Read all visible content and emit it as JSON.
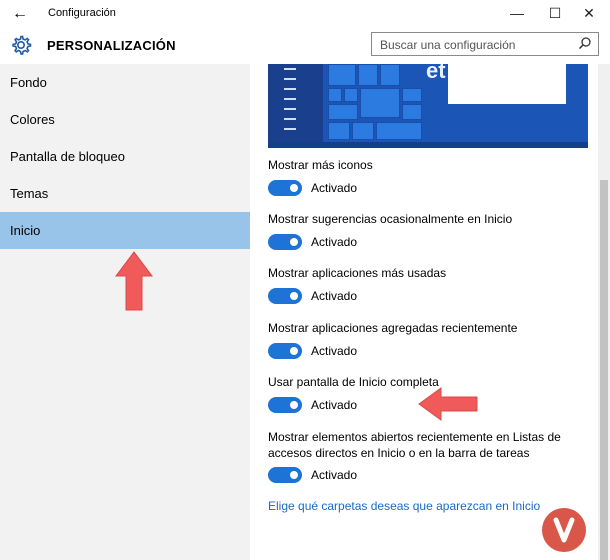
{
  "window": {
    "title": "Configuración",
    "back_glyph": "←",
    "minimize_glyph": "—",
    "maximize_glyph": "☐",
    "close_glyph": "✕"
  },
  "header": {
    "title": "PERSONALIZACIÓN",
    "search_placeholder": "Buscar una configuración"
  },
  "sidebar": {
    "items": [
      {
        "label": "Fondo"
      },
      {
        "label": "Colores"
      },
      {
        "label": "Pantalla de bloqueo"
      },
      {
        "label": "Temas"
      },
      {
        "label": "Inicio",
        "selected": true
      }
    ]
  },
  "settings": [
    {
      "label": "Mostrar más iconos",
      "state": "Activado"
    },
    {
      "label": "Mostrar sugerencias ocasionalmente en Inicio",
      "state": "Activado"
    },
    {
      "label": "Mostrar aplicaciones más usadas",
      "state": "Activado"
    },
    {
      "label": "Mostrar aplicaciones agregadas recientemente",
      "state": "Activado"
    },
    {
      "label": "Usar pantalla de Inicio completa",
      "state": "Activado"
    },
    {
      "label_line1": "Mostrar elementos abiertos recientemente en Listas de",
      "label_line2": "accesos directos en Inicio o en la barra de tareas",
      "state": "Activado"
    }
  ],
  "link": "Elige qué carpetas deseas que aparezcan en Inicio",
  "preview": {
    "text": "et"
  },
  "colors": {
    "accent": "#1e74d6",
    "selected_nav": "#99c4ea",
    "sidebar_bg": "#f2f2f2",
    "arrow": "#f05a5a",
    "link": "#1a6ac4"
  }
}
